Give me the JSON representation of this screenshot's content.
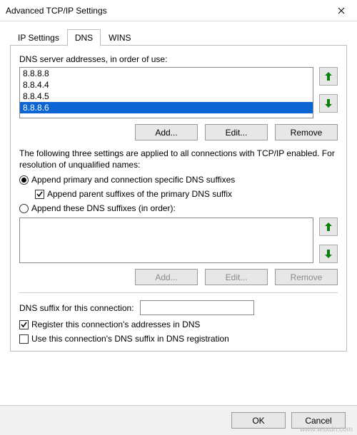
{
  "window": {
    "title": "Advanced TCP/IP Settings"
  },
  "tabs": {
    "t0": "IP Settings",
    "t1": "DNS",
    "t2": "WINS"
  },
  "dns": {
    "list_label": "DNS server addresses, in order of use:",
    "servers": {
      "s0": "8.8.8.8",
      "s1": "8.8.4.4",
      "s2": "8.8.4.5",
      "s3": "8.8.8.6"
    }
  },
  "buttons": {
    "add": "Add...",
    "edit": "Edit...",
    "remove": "Remove",
    "ok": "OK",
    "cancel": "Cancel"
  },
  "desc_text": "The following three settings are applied to all connections with TCP/IP enabled. For resolution of unqualified names:",
  "options": {
    "r1": "Append primary and connection specific DNS suffixes",
    "c1": "Append parent suffixes of the primary DNS suffix",
    "r2": "Append these DNS suffixes (in order):"
  },
  "suffix_field_label": "DNS suffix for this connection:",
  "checks": {
    "reg": "Register this connection's addresses in DNS",
    "use": "Use this connection's DNS suffix in DNS registration"
  },
  "watermark": "www.wsxdn.com"
}
